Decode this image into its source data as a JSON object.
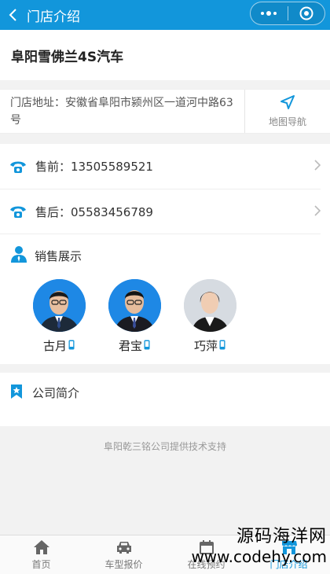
{
  "header": {
    "title": "门店介绍"
  },
  "store": {
    "name": "阜阳雪佛兰4S汽车"
  },
  "address": {
    "text": "门店地址：安徽省阜阳市颍州区一道河中路63号",
    "nav_label": "地图导航"
  },
  "contacts": [
    {
      "label": "售前：13505589521"
    },
    {
      "label": "售后：05583456789"
    }
  ],
  "sales": {
    "title": "销售展示",
    "people": [
      {
        "name": "古月"
      },
      {
        "name": "君宝"
      },
      {
        "name": "巧萍"
      }
    ]
  },
  "intro": {
    "title": "公司简介"
  },
  "footer": {
    "support": "阜阳乾三铭公司提供技术支持"
  },
  "tabs": [
    {
      "label": "首页"
    },
    {
      "label": "车型报价"
    },
    {
      "label": "在线预约"
    },
    {
      "label": "门店介绍"
    }
  ],
  "watermark": {
    "line1": "源码海洋网",
    "line2": "www.codehy.com"
  },
  "colors": {
    "accent": "#1296db"
  }
}
